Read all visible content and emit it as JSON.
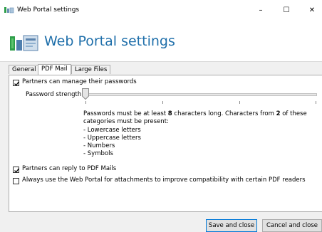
{
  "window": {
    "title": "Web Portal settings",
    "minimize_glyph": "–",
    "maximize_glyph": "☐",
    "close_glyph": "✕",
    "icon": "web-portal-icon"
  },
  "header": {
    "title": "Web Portal settings",
    "title_color": "#1f6faa",
    "icon": "web-portal-icon"
  },
  "tabs": [
    {
      "label": "General",
      "active": false
    },
    {
      "label": "PDF Mail",
      "active": true
    },
    {
      "label": "Large Files",
      "active": false
    }
  ],
  "pdf_mail": {
    "manage_passwords": {
      "label": "Partners can manage their passwords",
      "checked": true
    },
    "password_strength": {
      "label": "Password strength",
      "level": 0,
      "tick_count": 4
    },
    "description": {
      "line1_prefix": "Passwords must be at least ",
      "min_chars": "8",
      "line1_middle": " characters long. Characters from ",
      "category_count": "2",
      "line1_suffix": " of these",
      "line2": "categories must be present:",
      "categories": [
        "- Lowercase letters",
        "- Uppercase letters",
        "- Numbers",
        "- Symbols"
      ]
    },
    "reply_to_pdf": {
      "label": "Partners can reply to PDF Mails",
      "checked": true
    },
    "always_use_portal": {
      "label": "Always use the Web Portal for attachments to improve compatibility with certain PDF readers",
      "checked": false
    }
  },
  "footer": {
    "save_label": "Save and close",
    "cancel_label": "Cancel and close",
    "accent": "#0078d7"
  }
}
